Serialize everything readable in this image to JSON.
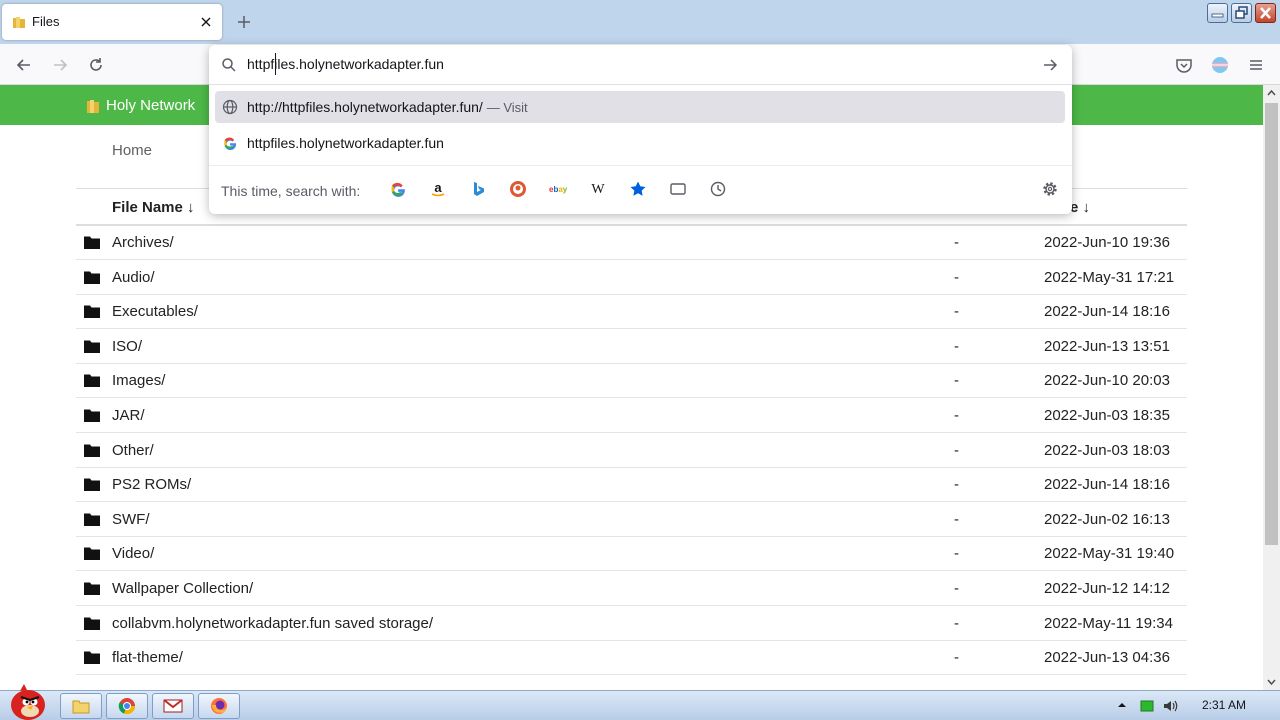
{
  "browser": {
    "tab_title": "Files",
    "url_input_value": "httpfiles.holynetworkadapter.fun",
    "url_results": [
      {
        "text": "http://httpfiles.holynetworkadapter.fun/",
        "action": "— Visit",
        "icon": "globe-icon"
      },
      {
        "text": "httpfiles.holynetworkadapter.fun",
        "action": "",
        "icon": "google-icon"
      }
    ],
    "oneoff_label": "This time, search with:",
    "search_engines": [
      "Google",
      "Amazon",
      "Bing",
      "DuckDuckGo",
      "eBay",
      "Wikipedia",
      "Bookmarks",
      "Tabs",
      "History"
    ]
  },
  "site": {
    "brand": "Holy Network",
    "breadcrumb": "Home",
    "col_name": "File Name ↓",
    "col_date": "e ↓",
    "rows": [
      {
        "name": "Archives/",
        "size": "-",
        "date": "2022-Jun-10 19:36"
      },
      {
        "name": "Audio/",
        "size": "-",
        "date": "2022-May-31 17:21"
      },
      {
        "name": "Executables/",
        "size": "-",
        "date": "2022-Jun-14 18:16"
      },
      {
        "name": "ISO/",
        "size": "-",
        "date": "2022-Jun-13 13:51"
      },
      {
        "name": "Images/",
        "size": "-",
        "date": "2022-Jun-10 20:03"
      },
      {
        "name": "JAR/",
        "size": "-",
        "date": "2022-Jun-03 18:35"
      },
      {
        "name": "Other/",
        "size": "-",
        "date": "2022-Jun-03 18:03"
      },
      {
        "name": "PS2 ROMs/",
        "size": "-",
        "date": "2022-Jun-14 18:16"
      },
      {
        "name": "SWF/",
        "size": "-",
        "date": "2022-Jun-02 16:13"
      },
      {
        "name": "Video/",
        "size": "-",
        "date": "2022-May-31 19:40"
      },
      {
        "name": "Wallpaper Collection/",
        "size": "-",
        "date": "2022-Jun-12 14:12"
      },
      {
        "name": "collabvm.holynetworkadapter.fun saved storage/",
        "size": "-",
        "date": "2022-May-11 19:34"
      },
      {
        "name": "flat-theme/",
        "size": "-",
        "date": "2022-Jun-13 04:36"
      }
    ]
  },
  "taskbar": {
    "clock": "2:31 AM",
    "items": [
      "angry-bird-start-icon",
      "folder-icon",
      "chrome-icon",
      "mail-icon",
      "firefox-icon"
    ]
  },
  "colors": {
    "accent_green": "#4db848",
    "tabstrip": "#bfd5ec",
    "selection": "#e0e0e6"
  }
}
